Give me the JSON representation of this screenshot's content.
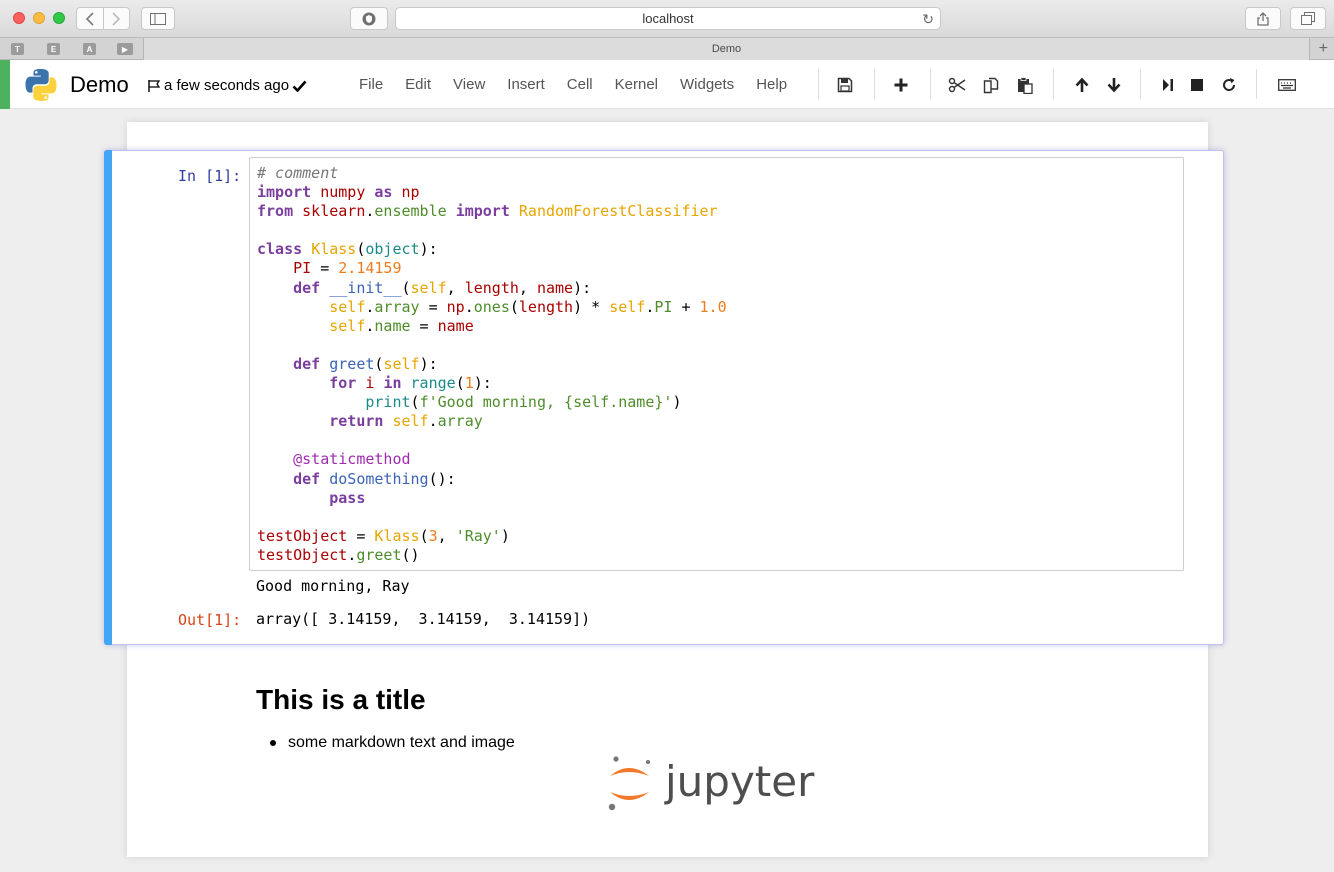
{
  "browser": {
    "url": "localhost",
    "tab_title": "Demo",
    "favorites": [
      "T",
      "E",
      "A",
      ""
    ]
  },
  "header": {
    "notebook_title": "Demo",
    "save_status": "a few seconds ago",
    "kernel_color": "#4db15e",
    "menu": [
      "File",
      "Edit",
      "View",
      "Insert",
      "Cell",
      "Kernel",
      "Widgets",
      "Help"
    ],
    "toolbar_icons": [
      "save-icon",
      "add-cell-icon",
      "cut-icon",
      "copy-icon",
      "paste-icon",
      "move-up-icon",
      "move-down-icon",
      "run-icon",
      "stop-icon",
      "restart-icon",
      "keyboard-icon"
    ]
  },
  "cell": {
    "prompt_in": "In [1]:",
    "prompt_out": "Out[1]:",
    "code_lines": [
      [
        [
          "c-comment",
          "# comment"
        ]
      ],
      [
        [
          "c-kw",
          "import"
        ],
        [
          "",
          " "
        ],
        [
          "c-var",
          "numpy"
        ],
        [
          "",
          " "
        ],
        [
          "c-kw",
          "as"
        ],
        [
          "",
          " "
        ],
        [
          "c-var",
          "np"
        ]
      ],
      [
        [
          "c-kw",
          "from"
        ],
        [
          "",
          " "
        ],
        [
          "c-var",
          "sklearn"
        ],
        [
          "",
          "."
        ],
        [
          "c-attr",
          "ensemble"
        ],
        [
          "",
          " "
        ],
        [
          "c-kw",
          "import"
        ],
        [
          "",
          " "
        ],
        [
          "c-cls",
          "RandomForestClassifier"
        ]
      ],
      [],
      [
        [
          "c-kw",
          "class"
        ],
        [
          "",
          " "
        ],
        [
          "c-cls",
          "Klass"
        ],
        [
          "",
          "("
        ],
        [
          "c-builtin",
          "object"
        ],
        [
          "",
          "):"
        ]
      ],
      [
        [
          "",
          "    "
        ],
        [
          "c-var",
          "PI"
        ],
        [
          "",
          " = "
        ],
        [
          "c-num",
          "2.14159"
        ]
      ],
      [
        [
          "",
          "    "
        ],
        [
          "c-def",
          "def"
        ],
        [
          "",
          " "
        ],
        [
          "c-fn",
          "__init__"
        ],
        [
          "",
          "("
        ],
        [
          "c-self",
          "self"
        ],
        [
          "",
          ", "
        ],
        [
          "c-var",
          "length"
        ],
        [
          "",
          ", "
        ],
        [
          "c-var",
          "name"
        ],
        [
          "",
          "):"
        ]
      ],
      [
        [
          "",
          "        "
        ],
        [
          "c-self",
          "self"
        ],
        [
          "",
          "."
        ],
        [
          "c-attr",
          "array"
        ],
        [
          "",
          " = "
        ],
        [
          "c-var",
          "np"
        ],
        [
          "",
          "."
        ],
        [
          "c-attr",
          "ones"
        ],
        [
          "",
          "("
        ],
        [
          "c-var",
          "length"
        ],
        [
          "",
          ") * "
        ],
        [
          "c-self",
          "self"
        ],
        [
          "",
          "."
        ],
        [
          "c-attr",
          "PI"
        ],
        [
          "",
          " + "
        ],
        [
          "c-num",
          "1.0"
        ]
      ],
      [
        [
          "",
          "        "
        ],
        [
          "c-self",
          "self"
        ],
        [
          "",
          "."
        ],
        [
          "c-attr",
          "name"
        ],
        [
          "",
          " = "
        ],
        [
          "c-var",
          "name"
        ]
      ],
      [],
      [
        [
          "",
          "    "
        ],
        [
          "c-def",
          "def"
        ],
        [
          "",
          " "
        ],
        [
          "c-fn",
          "greet"
        ],
        [
          "",
          "("
        ],
        [
          "c-self",
          "self"
        ],
        [
          "",
          "):"
        ]
      ],
      [
        [
          "",
          "        "
        ],
        [
          "c-kw",
          "for"
        ],
        [
          "",
          " "
        ],
        [
          "c-var",
          "i"
        ],
        [
          "",
          " "
        ],
        [
          "c-kw",
          "in"
        ],
        [
          "",
          " "
        ],
        [
          "c-builtin",
          "range"
        ],
        [
          "",
          "("
        ],
        [
          "c-num",
          "1"
        ],
        [
          "",
          "):"
        ]
      ],
      [
        [
          "",
          "            "
        ],
        [
          "c-builtin",
          "print"
        ],
        [
          "",
          "("
        ],
        [
          "c-str",
          "f'Good morning, {self.name}'"
        ],
        [
          "",
          ")"
        ]
      ],
      [
        [
          "",
          "        "
        ],
        [
          "c-kw",
          "return"
        ],
        [
          "",
          " "
        ],
        [
          "c-self",
          "self"
        ],
        [
          "",
          "."
        ],
        [
          "c-attr",
          "array"
        ]
      ],
      [],
      [
        [
          "",
          "    "
        ],
        [
          "c-deco",
          "@staticmethod"
        ]
      ],
      [
        [
          "",
          "    "
        ],
        [
          "c-def",
          "def"
        ],
        [
          "",
          " "
        ],
        [
          "c-fn",
          "doSomething"
        ],
        [
          "",
          "():"
        ]
      ],
      [
        [
          "",
          "        "
        ],
        [
          "c-kw",
          "pass"
        ]
      ],
      [],
      [
        [
          "c-var",
          "testObject"
        ],
        [
          "",
          " = "
        ],
        [
          "c-cls",
          "Klass"
        ],
        [
          "",
          "("
        ],
        [
          "c-num",
          "3"
        ],
        [
          "",
          ", "
        ],
        [
          "c-str",
          "'Ray'"
        ],
        [
          "",
          ")"
        ]
      ],
      [
        [
          "c-var",
          "testObject"
        ],
        [
          "",
          "."
        ],
        [
          "c-attr",
          "greet"
        ],
        [
          "",
          "()"
        ]
      ]
    ],
    "stdout": "Good morning, Ray",
    "result": "array([ 3.14159,  3.14159,  3.14159])"
  },
  "markdown": {
    "title": "This is a title",
    "bullets": [
      "some markdown text and image"
    ],
    "logo_text": "jupyter"
  }
}
